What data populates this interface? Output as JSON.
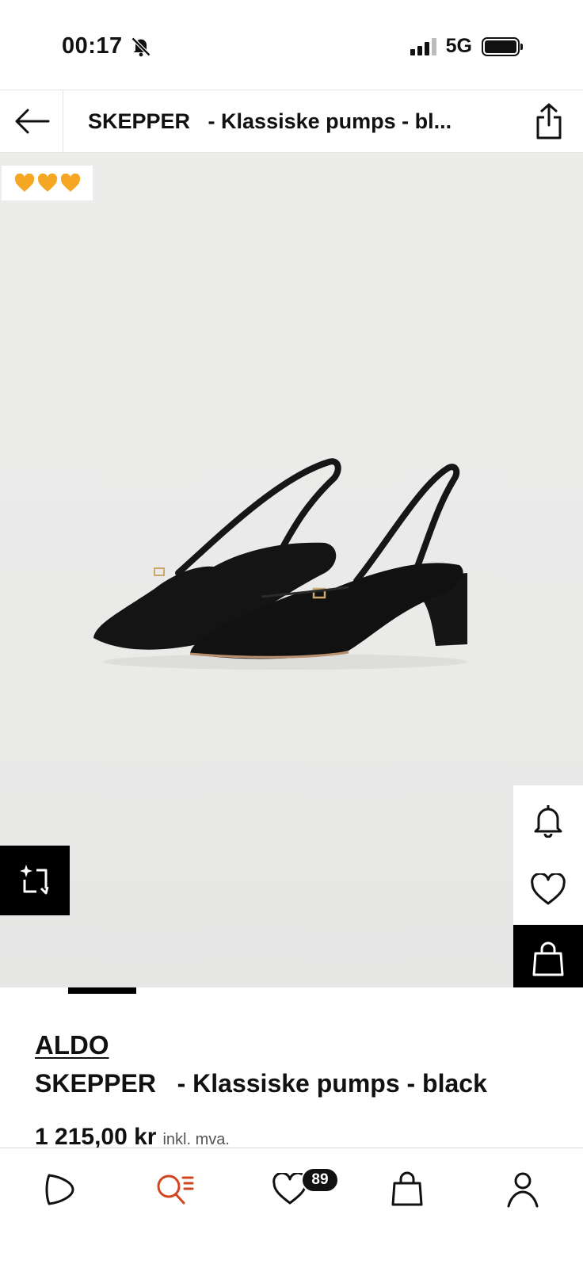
{
  "status_bar": {
    "time": "00:17",
    "network": "5G"
  },
  "header": {
    "title": "SKEPPER   - Klassiske pumps - bl..."
  },
  "image": {
    "badge_hearts": 3
  },
  "product": {
    "brand": "ALDO",
    "name": "SKEPPER   - Klassiske pumps - black",
    "price": "1 215,00 kr",
    "vat_note": "inkl. mva."
  },
  "bottom_nav": {
    "wishlist_count": "89"
  },
  "colors": {
    "accent": "#d2461f",
    "badge_heart": "#f5a623"
  }
}
